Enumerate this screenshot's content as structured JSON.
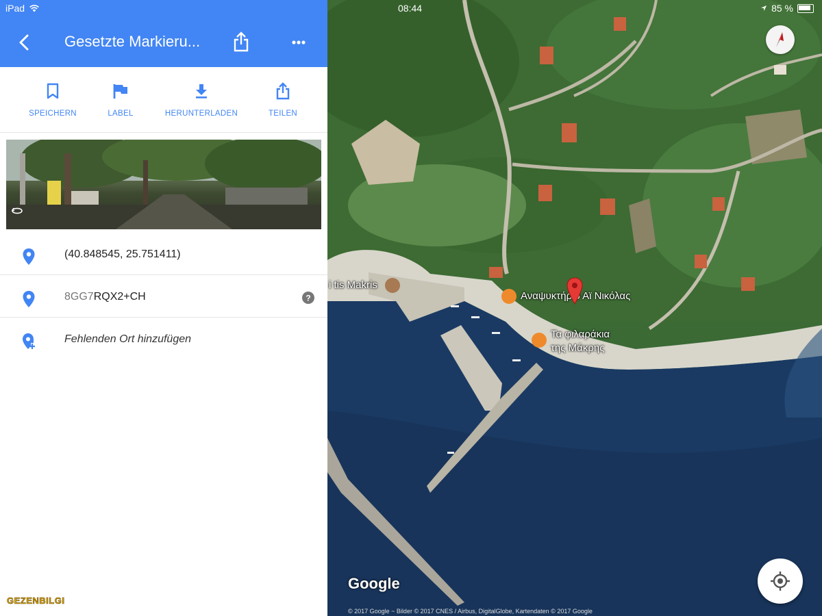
{
  "status": {
    "device": "iPad",
    "time": "08:44",
    "battery": "85 %"
  },
  "header": {
    "title": "Gesetzte Markieru..."
  },
  "actions": [
    {
      "label": "SPEICHERN",
      "icon": "bookmark-icon"
    },
    {
      "label": "LABEL",
      "icon": "flag-icon"
    },
    {
      "label": "HERUNTERLADEN",
      "icon": "download-icon"
    },
    {
      "label": "TEILEN",
      "icon": "share-icon"
    }
  ],
  "details": {
    "coordinates": "(40.848545, 25.751411)",
    "pluscode_prefix": "8GG7",
    "pluscode_suffix": "RQX2+CH",
    "add_missing_place": "Fehlenden Ort hinzufügen"
  },
  "map": {
    "labels": {
      "poi_left": "i tis Makris",
      "poi_cafe": "Αναψυκτήριο Αϊ Νικόλας",
      "poi_restaurant_line1": "Τα φιλαράκια",
      "poi_restaurant_line2": "της Μάκρης"
    },
    "logo": "Google",
    "copyright": "© 2017 Google ~ Bilder © 2017 CNES / Airbus, DigitalGlobe, Kartendaten © 2017 Google"
  },
  "watermark": "GEZENBILGI",
  "colors": {
    "accent": "#4285f4",
    "food_poi": "#ef8a2c",
    "marker": "#e53935"
  }
}
